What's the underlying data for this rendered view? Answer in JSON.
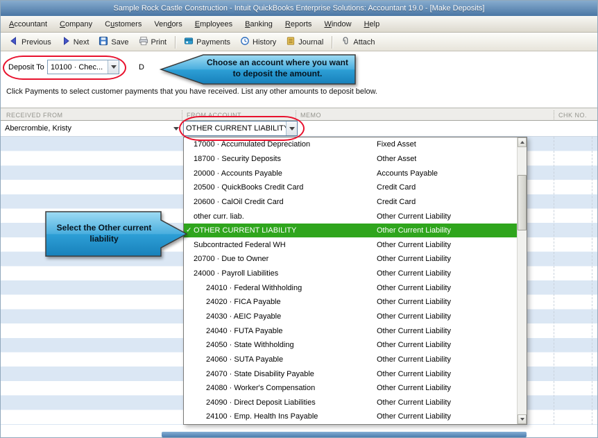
{
  "window": {
    "title": "Sample Rock Castle Construction  - Intuit QuickBooks Enterprise Solutions: Accountant 19.0 - [Make Deposits]",
    "accent_blue": "#4a76a4",
    "highlight_red": "#e8112d",
    "selected_green": "#2fa51d"
  },
  "menu": {
    "items": [
      {
        "pre": "",
        "key": "A",
        "post": "ccountant"
      },
      {
        "pre": "",
        "key": "C",
        "post": "ompany"
      },
      {
        "pre": "C",
        "key": "u",
        "post": "stomers"
      },
      {
        "pre": "Ven",
        "key": "d",
        "post": "ors"
      },
      {
        "pre": "",
        "key": "E",
        "post": "mployees"
      },
      {
        "pre": "",
        "key": "B",
        "post": "anking"
      },
      {
        "pre": "",
        "key": "R",
        "post": "eports"
      },
      {
        "pre": "",
        "key": "W",
        "post": "indow"
      },
      {
        "pre": "",
        "key": "H",
        "post": "elp"
      }
    ]
  },
  "toolbar": {
    "previous": "Previous",
    "next": "Next",
    "save": "Save",
    "print": "Print",
    "payments": "Payments",
    "history": "History",
    "journal": "Journal",
    "attach": "Attach"
  },
  "deposit_to": {
    "label": "Deposit To",
    "value": "10100 · Chec...",
    "date_label_partial": "D"
  },
  "instruction": "Click Payments to select customer payments that you have received. List any other amounts to deposit below.",
  "callouts": {
    "account": "Choose an account where you want to deposit the amount.",
    "liability": "Select the Other current liability"
  },
  "grid": {
    "headers": {
      "received_from": "RECEIVED FROM",
      "from_account": "FROM ACCOUNT",
      "memo": "MEMO",
      "chk_no": "CHK NO."
    },
    "row": {
      "received_from": "Abercrombie, Kristy",
      "from_account": "OTHER CURRENT LIABILITY"
    }
  },
  "account_dropdown": {
    "items": [
      {
        "name": "17000 · Accumulated Depreciation",
        "type": "Fixed Asset"
      },
      {
        "name": "18700 · Security Deposits",
        "type": "Other Asset"
      },
      {
        "name": "20000 · Accounts Payable",
        "type": "Accounts Payable"
      },
      {
        "name": "20500 · QuickBooks Credit Card",
        "type": "Credit Card"
      },
      {
        "name": "20600 · CalOil Credit Card",
        "type": "Credit Card"
      },
      {
        "name": "other curr. liab.",
        "type": "Other Current Liability"
      },
      {
        "name": "OTHER CURRENT LIABILITY",
        "type": "Other Current Liability",
        "selected": true
      },
      {
        "name": "Subcontracted Federal WH",
        "type": "Other Current Liability"
      },
      {
        "name": "20700 · Due to Owner",
        "type": "Other Current Liability"
      },
      {
        "name": "24000 · Payroll Liabilities",
        "type": "Other Current Liability"
      },
      {
        "name": "24010 · Federal Withholding",
        "type": "Other Current Liability",
        "indent": 1
      },
      {
        "name": "24020 · FICA Payable",
        "type": "Other Current Liability",
        "indent": 1
      },
      {
        "name": "24030 · AEIC Payable",
        "type": "Other Current Liability",
        "indent": 1
      },
      {
        "name": "24040 · FUTA Payable",
        "type": "Other Current Liability",
        "indent": 1
      },
      {
        "name": "24050 · State Withholding",
        "type": "Other Current Liability",
        "indent": 1
      },
      {
        "name": "24060 · SUTA Payable",
        "type": "Other Current Liability",
        "indent": 1
      },
      {
        "name": "24070 · State Disability Payable",
        "type": "Other Current Liability",
        "indent": 1
      },
      {
        "name": "24080 · Worker's Compensation",
        "type": "Other Current Liability",
        "indent": 1
      },
      {
        "name": "24090 · Direct Deposit Liabilities",
        "type": "Other Current Liability",
        "indent": 1
      },
      {
        "name": "24100 · Emp. Health Ins Payable",
        "type": "Other Current Liability",
        "indent": 1
      }
    ]
  }
}
